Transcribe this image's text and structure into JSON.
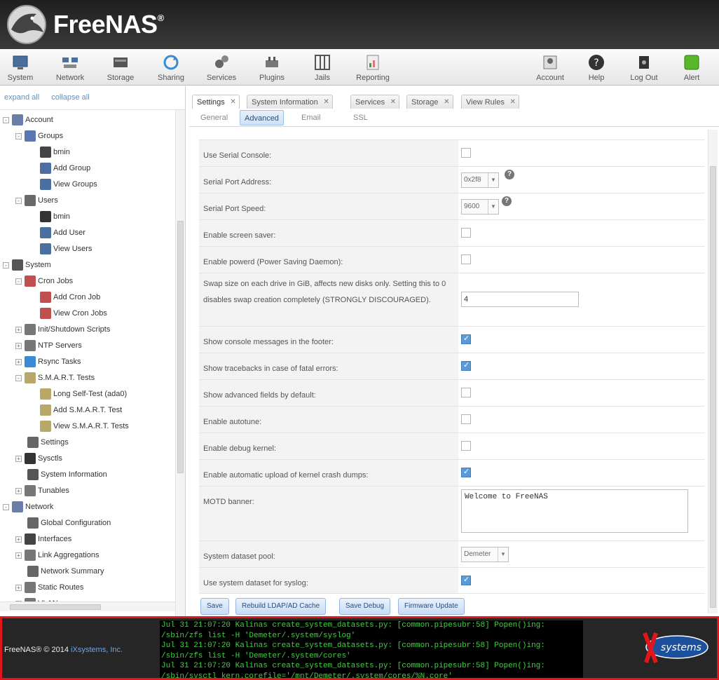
{
  "header": {
    "brand": "FreeNAS",
    "brand_mark": "®"
  },
  "toolbar": {
    "items": [
      {
        "label": "System",
        "icon": "system-icon"
      },
      {
        "label": "Network",
        "icon": "network-icon"
      },
      {
        "label": "Storage",
        "icon": "storage-icon"
      },
      {
        "label": "Sharing",
        "icon": "sharing-icon"
      },
      {
        "label": "Services",
        "icon": "services-icon"
      },
      {
        "label": "Plugins",
        "icon": "plugins-icon"
      },
      {
        "label": "Jails",
        "icon": "jails-icon"
      },
      {
        "label": "Reporting",
        "icon": "reporting-icon"
      },
      {
        "label": "Account",
        "icon": "account-icon"
      },
      {
        "label": "Help",
        "icon": "help-icon"
      },
      {
        "label": "Log Out",
        "icon": "logout-icon"
      },
      {
        "label": "Alert",
        "icon": "alert-icon"
      }
    ]
  },
  "tree": {
    "expand_all": "expand all",
    "collapse_all": "collapse all",
    "nodes": [
      {
        "label": "Account",
        "icon": "account-icon",
        "expander": "-"
      },
      {
        "label": "Groups",
        "icon": "groups-icon",
        "expander": "-"
      },
      {
        "label": "bmin",
        "icon": "group-icon"
      },
      {
        "label": "Add Group",
        "icon": "add-group-icon"
      },
      {
        "label": "View Groups",
        "icon": "view-groups-icon"
      },
      {
        "label": "Users",
        "icon": "users-icon",
        "expander": "-"
      },
      {
        "label": "bmin",
        "icon": "user-icon"
      },
      {
        "label": "Add User",
        "icon": "add-user-icon"
      },
      {
        "label": "View Users",
        "icon": "view-users-icon"
      },
      {
        "label": "System",
        "icon": "system-icon",
        "expander": "-"
      },
      {
        "label": "Cron Jobs",
        "icon": "cron-icon",
        "expander": "-"
      },
      {
        "label": "Add Cron Job",
        "icon": "add-cron-icon"
      },
      {
        "label": "View Cron Jobs",
        "icon": "view-cron-icon"
      },
      {
        "label": "Init/Shutdown Scripts",
        "icon": "script-icon",
        "expander": "+"
      },
      {
        "label": "NTP Servers",
        "icon": "ntp-icon",
        "expander": "+"
      },
      {
        "label": "Rsync Tasks",
        "icon": "rsync-icon",
        "expander": "+"
      },
      {
        "label": "S.M.A.R.T. Tests",
        "icon": "smart-icon",
        "expander": "-"
      },
      {
        "label": "Long Self-Test (ada0)",
        "icon": "smart-test-icon"
      },
      {
        "label": "Add S.M.A.R.T. Test",
        "icon": "add-smart-icon"
      },
      {
        "label": "View S.M.A.R.T. Tests",
        "icon": "view-smart-icon"
      },
      {
        "label": "Settings",
        "icon": "settings-icon"
      },
      {
        "label": "Sysctls",
        "icon": "sysctl-icon",
        "expander": "+"
      },
      {
        "label": "System Information",
        "icon": "info-icon"
      },
      {
        "label": "Tunables",
        "icon": "tunable-icon",
        "expander": "+"
      },
      {
        "label": "Network",
        "icon": "network-icon",
        "expander": "-"
      },
      {
        "label": "Global Configuration",
        "icon": "wrench-icon"
      },
      {
        "label": "Interfaces",
        "icon": "interface-icon",
        "expander": "+"
      },
      {
        "label": "Link Aggregations",
        "icon": "lagg-icon",
        "expander": "+"
      },
      {
        "label": "Network Summary",
        "icon": "wrench-icon"
      },
      {
        "label": "Static Routes",
        "icon": "route-icon",
        "expander": "+"
      },
      {
        "label": "VLANs",
        "icon": "vlan-icon",
        "expander": "+"
      }
    ]
  },
  "tabs": [
    {
      "label": "Settings",
      "active": true
    },
    {
      "label": "System Information"
    },
    {
      "label": "Services"
    },
    {
      "label": "Storage"
    },
    {
      "label": "View Rules"
    }
  ],
  "subtabs": [
    {
      "label": "General"
    },
    {
      "label": "Advanced",
      "active": true
    },
    {
      "label": "Email"
    },
    {
      "label": "SSL"
    }
  ],
  "form": {
    "rows": [
      {
        "label": "Use Serial Console:",
        "type": "checkbox",
        "checked": false
      },
      {
        "label": "Serial Port Address:",
        "type": "select",
        "value": "0x2f8"
      },
      {
        "label": "Serial Port Speed:",
        "type": "select",
        "value": "9600"
      },
      {
        "label": "Enable screen saver:",
        "type": "checkbox",
        "checked": false
      },
      {
        "label": "Enable powerd (Power Saving Daemon):",
        "type": "checkbox",
        "checked": false
      },
      {
        "label": "Swap size on each drive in GiB, affects new disks only. Setting this to 0 disables swap creation completely (STRONGLY DISCOURAGED).",
        "type": "text",
        "value": "4"
      },
      {
        "label": "Show console messages in the footer:",
        "type": "checkbox",
        "checked": true
      },
      {
        "label": "Show tracebacks in case of fatal errors:",
        "type": "checkbox",
        "checked": true
      },
      {
        "label": "Show advanced fields by default:",
        "type": "checkbox",
        "checked": false
      },
      {
        "label": "Enable autotune:",
        "type": "checkbox",
        "checked": false
      },
      {
        "label": "Enable debug kernel:",
        "type": "checkbox",
        "checked": false
      },
      {
        "label": "Enable automatic upload of kernel crash dumps:",
        "type": "checkbox",
        "checked": true
      },
      {
        "label": "MOTD banner:",
        "type": "textarea",
        "value": "Welcome to FreeNAS"
      },
      {
        "label": "System dataset pool:",
        "type": "select",
        "value": "Demeter"
      },
      {
        "label": "Use system dataset for syslog:",
        "type": "checkbox",
        "checked": true
      }
    ],
    "buttons": [
      "Save",
      "Rebuild LDAP/AD Cache",
      "Save Debug",
      "Firmware Update"
    ]
  },
  "footer": {
    "copyright": "FreeNAS® © 2014",
    "company": "iXsystems, Inc.",
    "company_logo": "systems",
    "console_lines": [
      "Jul 31 21:07:20 Kalinas create_system_datasets.py: [common.pipesubr:58] Popen()ing:",
      "/sbin/zfs list -H 'Demeter/.system/syslog'",
      "Jul 31 21:07:20 Kalinas create_system_datasets.py: [common.pipesubr:58] Popen()ing:",
      "/sbin/zfs list -H 'Demeter/.system/cores'",
      "Jul 31 21:07:20 Kalinas create_system_datasets.py: [common.pipesubr:58] Popen()ing:",
      "/sbin/sysctl kern.corefile='/mnt/Demeter/.system/cores/%N.core'"
    ]
  },
  "colors": {
    "header_bg": "#2b2b2b",
    "accent": "#5b9ad6",
    "footer_border": "#e0161b",
    "console_text": "#3fcf3f"
  }
}
